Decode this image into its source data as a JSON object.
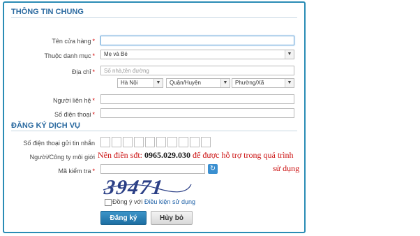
{
  "section1": {
    "title": "THÔNG TIN CHUNG"
  },
  "fields": {
    "store_name": {
      "label": "Tên cửa hàng",
      "value": ""
    },
    "category": {
      "label": "Thuộc danh mục",
      "value": "Mẹ và Bé"
    },
    "address": {
      "label": "Địa chỉ",
      "placeholder": "Số nhà,tên đường"
    },
    "city": {
      "value": "Hà Nội"
    },
    "district": {
      "value": "Quận/Huyện"
    },
    "ward": {
      "value": "Phường/Xã"
    },
    "contact": {
      "label": "Người liên hệ",
      "value": ""
    },
    "phone": {
      "label": "Số điện thoại",
      "value": ""
    }
  },
  "required_mark": "*",
  "section2": {
    "title": "ĐĂNG KÝ DỊCH VỤ"
  },
  "service": {
    "sms_phone_label": "Số điện thoại gửi tin nhắn",
    "referrer_label": "Người/Công ty môi giới",
    "note_prefix": "Nên điền sđt: ",
    "note_phone": "0965.029.030",
    "note_suffix": " để được hỗ trợ trong quá trình",
    "note_line2": "sử dụng",
    "captcha_label": "Mã kiểm tra",
    "captcha_text": "39471",
    "agree_text": "Đồng ý với ",
    "agree_link": "Điều kiện sử dụng"
  },
  "buttons": {
    "register": "Đăng ký",
    "cancel": "Hủy bỏ"
  },
  "colors": {
    "accent": "#2a8cb5",
    "title": "#2b6aa0",
    "note": "#cc1111",
    "required": "#d40000"
  },
  "icons": {
    "dropdown": "chevron-down-icon",
    "refresh": "refresh-icon"
  }
}
